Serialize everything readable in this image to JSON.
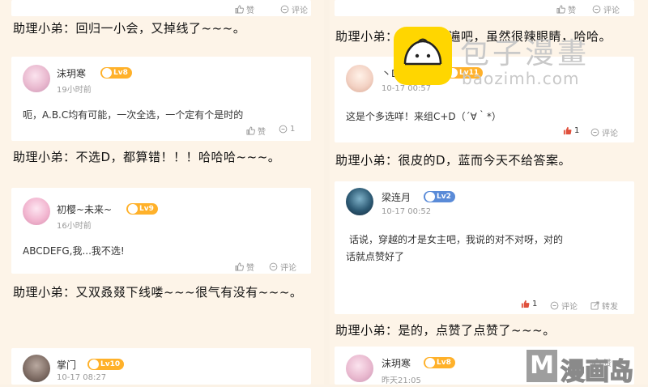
{
  "left": {
    "top_actions": {
      "like": "赞",
      "comment": "评论"
    },
    "narr1": "助理小弟：回归一小会，又掉线了~~~。",
    "card1": {
      "name": "沫玥寒",
      "level": "Lv8",
      "time": "19小时前",
      "text": "呃，A.B.C均有可能，一次全选，一个定有个是时的",
      "like": "赞",
      "comment": "1"
    },
    "narr2": "助理小弟：不选D，都算错！！！哈哈哈~~~。",
    "card2": {
      "name": "初樱~未来~",
      "level": "Lv9",
      "time": "16小时前",
      "text": "ABCDEFG,我...我不选!",
      "like": "赞",
      "comment": "评论"
    },
    "narr3": "助理小弟：又双叒叕下线喽~~~很气有没有~~~。",
    "card3": {
      "name": "掌门",
      "level": "Lv10",
      "time": "10-17 08:27"
    }
  },
  "right": {
    "top_actions": {
      "like": "赞",
      "comment": "评论"
    },
    "narr1": "助理小弟：去重看一遍吧，虽然很辣眼睛，哈哈。",
    "card1": {
      "name": "丶D",
      "level": "Lv11",
      "time": "10-17 00:57",
      "text": "这是个多选咩！来组C+D（´∀｀*）",
      "like": "1",
      "comment": "评论"
    },
    "narr2": "助理小弟：很皮的D，蓝而今天不给答案。",
    "card2": {
      "name": "梁连月",
      "level": "Lv2",
      "time": "10-17 00:52",
      "text_line1": "话说，穿越的才是女主吧，我说的对不对呀，对的",
      "text_line2": "话就点赞好了",
      "like": "1",
      "comment": "评论",
      "share": "转发"
    },
    "narr3": "助理小弟：是的，点赞了点赞了~~~。",
    "card3": {
      "name": "沫玥寒",
      "level": "Lv8",
      "time": "昨天21:05",
      "like": "赞"
    }
  },
  "watermark": {
    "title": "包子漫畫",
    "url": "baozimh.com"
  },
  "corner_logo": {
    "letter": "M",
    "text": "漫画岛"
  },
  "colors": {
    "badge_orange": "#ffb12a",
    "badge_blue": "#5a8bd8",
    "like_red": "#e0503c",
    "bg": "#fbf2e6"
  }
}
